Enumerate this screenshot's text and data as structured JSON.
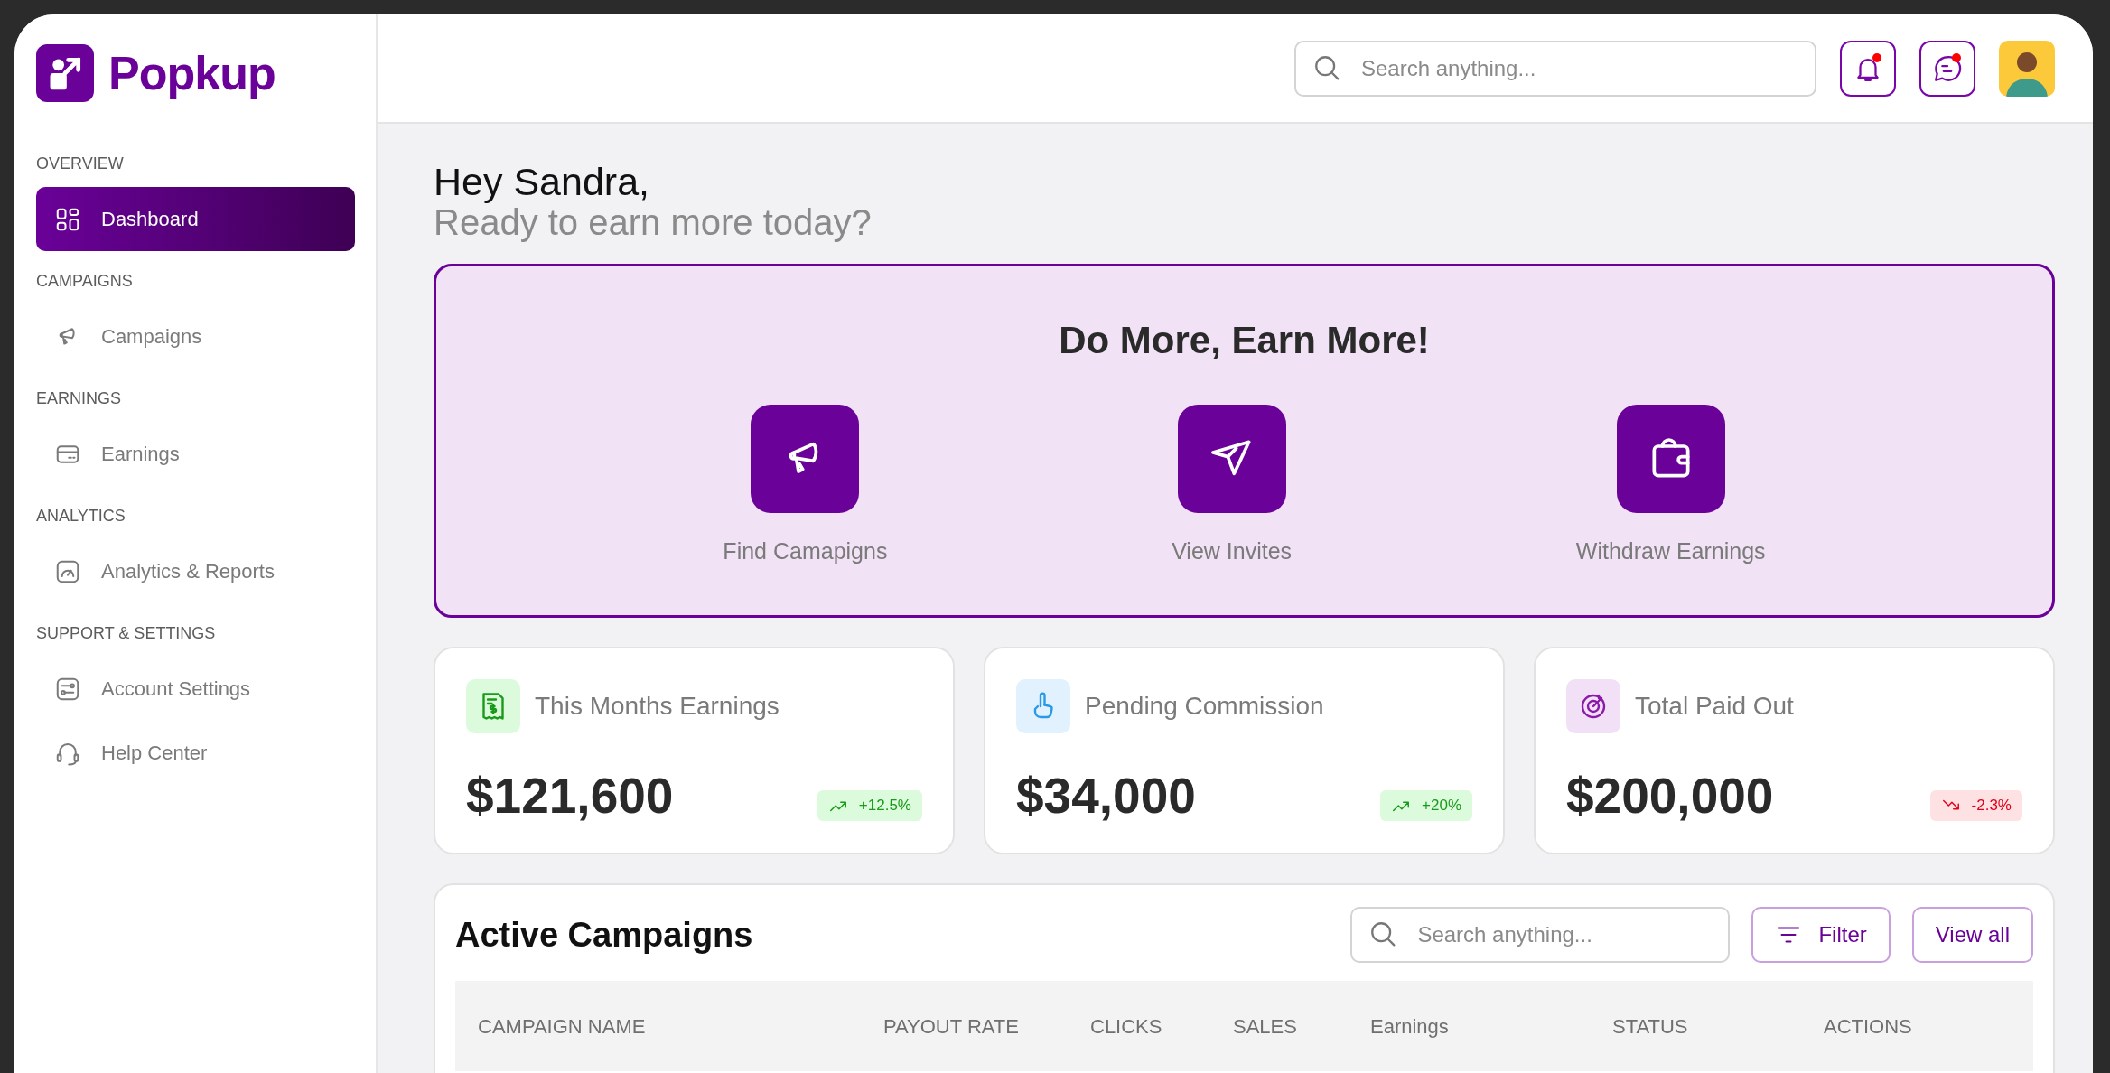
{
  "brand": {
    "name": "Popkup"
  },
  "sidebar": {
    "sections": [
      {
        "heading": "OVERVIEW",
        "items": [
          {
            "label": "Dashboard",
            "selected": true
          }
        ]
      },
      {
        "heading": "CAMPAIGNS",
        "items": [
          {
            "label": "Campaigns",
            "selected": false
          }
        ]
      },
      {
        "heading": "EARNINGS",
        "items": [
          {
            "label": "Earnings",
            "selected": false
          }
        ]
      },
      {
        "heading": "ANALYTICS",
        "items": [
          {
            "label": "Analytics & Reports",
            "selected": false
          }
        ]
      },
      {
        "heading": "SUPPORT & SETTINGS",
        "items": [
          {
            "label": "Account Settings",
            "selected": false
          },
          {
            "label": "Help Center",
            "selected": false
          }
        ]
      }
    ]
  },
  "header": {
    "search": {
      "placeholder": "Search anything..."
    },
    "notifications": {
      "unread": true
    },
    "messages": {
      "unread": true
    }
  },
  "greeting": {
    "title": "Hey Sandra,",
    "subtitle": "Ready to earn more today?"
  },
  "banner": {
    "title": "Do More, Earn More!",
    "actions": [
      {
        "label": "Find Camapigns"
      },
      {
        "label": "View Invites"
      },
      {
        "label": "Withdraw Earnings"
      }
    ]
  },
  "stats": [
    {
      "label": "This Months Earnings",
      "value": "$121,600",
      "change": "+12.5%",
      "kind": "up"
    },
    {
      "label": "Pending Commission",
      "value": "$34,000",
      "change": "+20%",
      "kind": "up"
    },
    {
      "label": "Total Paid Out",
      "value": "$200,000",
      "change": "-2.3%",
      "kind": "down"
    }
  ],
  "campaigns": {
    "title": "Active Campaigns",
    "search": {
      "placeholder": "Search anything..."
    },
    "buttons": [
      {
        "label": "Filter",
        "kind": "filter"
      },
      {
        "label": "View all",
        "kind": "plain"
      }
    ],
    "columns": [
      "CAMPAIGN NAME",
      "PAYOUT RATE",
      "CLICKS",
      "SALES",
      "Earnings",
      "STATUS",
      "ACTIONS"
    ]
  }
}
